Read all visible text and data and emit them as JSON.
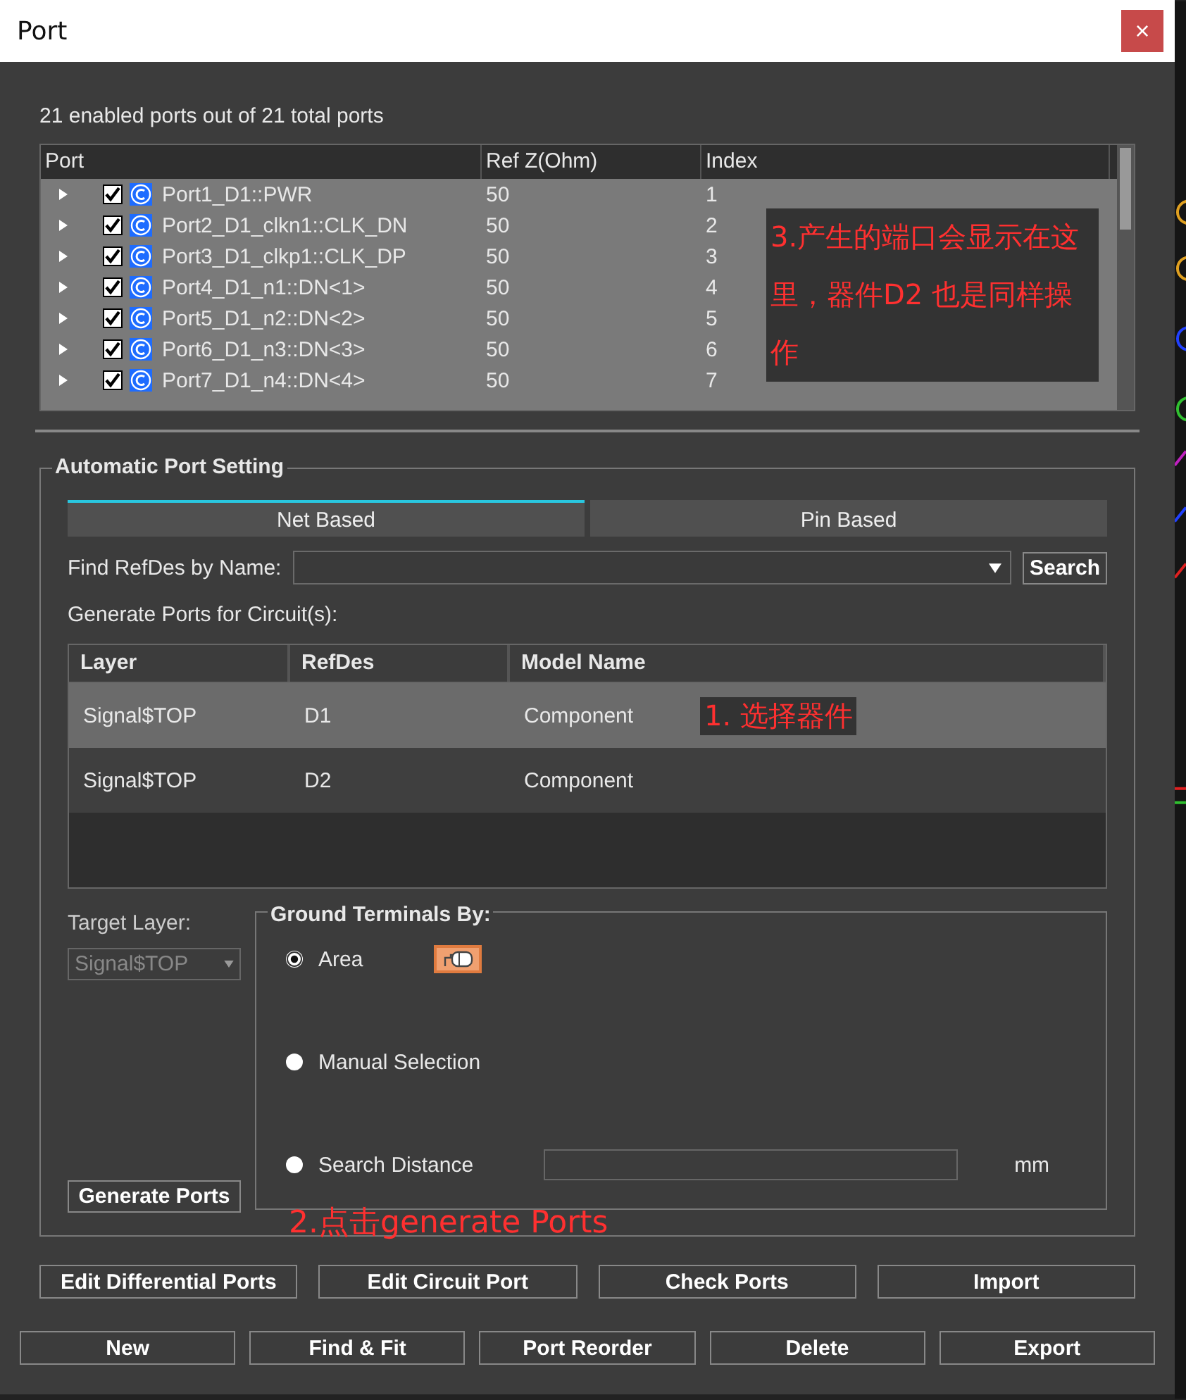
{
  "window": {
    "title": "Port",
    "close": "×"
  },
  "summary": "21 enabled ports out of 21 total ports",
  "port_table": {
    "columns": [
      "Port",
      "Ref Z(Ohm)",
      "Index"
    ],
    "rows": [
      {
        "port": "Port1_D1::PWR",
        "refz": "50",
        "index": "1",
        "checked": true,
        "expanded": false
      },
      {
        "port": "Port2_D1_clkn1::CLK_DN",
        "refz": "50",
        "index": "2",
        "checked": true,
        "expanded": false
      },
      {
        "port": "Port3_D1_clkp1::CLK_DP",
        "refz": "50",
        "index": "3",
        "checked": true,
        "expanded": false
      },
      {
        "port": "Port4_D1_n1::DN<1>",
        "refz": "50",
        "index": "4",
        "checked": true,
        "expanded": false
      },
      {
        "port": "Port5_D1_n2::DN<2>",
        "refz": "50",
        "index": "5",
        "checked": true,
        "expanded": false
      },
      {
        "port": "Port6_D1_n3::DN<3>",
        "refz": "50",
        "index": "6",
        "checked": true,
        "expanded": false
      },
      {
        "port": "Port7_D1_n4::DN<4>",
        "refz": "50",
        "index": "7",
        "checked": true,
        "expanded": false
      }
    ]
  },
  "auto_port_setting": {
    "title": "Automatic Port Setting",
    "tabs": [
      {
        "label": "Net Based",
        "selected": true
      },
      {
        "label": "Pin Based",
        "selected": false
      }
    ],
    "find_label": "Find RefDes by Name:",
    "search_button": "Search",
    "generate_label": "Generate Ports for Circuit(s):",
    "circuit_table": {
      "columns": [
        "Layer",
        "RefDes",
        "Model Name"
      ],
      "rows": [
        {
          "layer": "Signal$TOP",
          "refdes": "D1",
          "model": "Component",
          "selected": true
        },
        {
          "layer": "Signal$TOP",
          "refdes": "D2",
          "model": "Component",
          "selected": false
        }
      ]
    },
    "target_layer": {
      "label": "Target Layer:",
      "value": "Signal$TOP",
      "disabled": true
    },
    "generate_button": "Generate Ports",
    "ground_terminals": {
      "title": "Ground Terminals By:",
      "options": [
        {
          "label": "Area",
          "selected": true
        },
        {
          "label": "Manual Selection",
          "selected": false
        },
        {
          "label": "Search Distance",
          "selected": false
        }
      ],
      "unit": "mm"
    }
  },
  "buttons_row_1": [
    "Edit Differential Ports",
    "Edit Circuit Port",
    "Check Ports",
    "Import"
  ],
  "buttons_row_2": [
    "New",
    "Find & Fit",
    "Port Reorder",
    "Delete",
    "Export"
  ],
  "annotations": [
    {
      "kind": "ports",
      "text": "3.产生的端口会显示在这里，器件D2 也是同样操作"
    },
    {
      "kind": "select",
      "text": "1. 选择器件"
    },
    {
      "kind": "generate",
      "text": "2.点击generate Ports"
    }
  ]
}
